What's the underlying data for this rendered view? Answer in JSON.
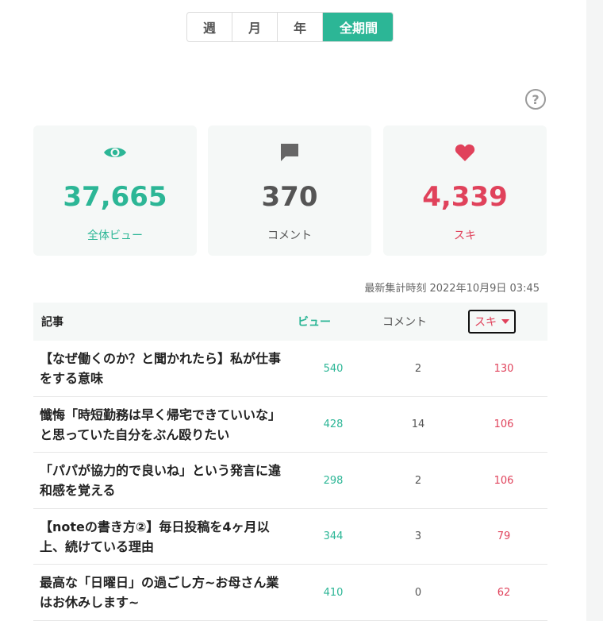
{
  "period_tabs": [
    {
      "label": "週",
      "active": false
    },
    {
      "label": "月",
      "active": false
    },
    {
      "label": "年",
      "active": false
    },
    {
      "label": "全期間",
      "active": true
    }
  ],
  "help_icon": {
    "glyph": "?"
  },
  "stats": {
    "views": {
      "value": "37,665",
      "label": "全体ビュー",
      "icon": "eye-icon"
    },
    "comments": {
      "value": "370",
      "label": "コメント",
      "icon": "comment-icon"
    },
    "likes": {
      "value": "4,339",
      "label": "スキ",
      "icon": "heart-icon"
    }
  },
  "updated_text": "最新集計時刻 2022年10月9日 03:45",
  "table": {
    "headers": {
      "article": "記事",
      "views": "ビュー",
      "comments": "コメント",
      "likes": "スキ"
    },
    "rows": [
      {
        "title": "【なぜ働くのか？と聞かれたら】私が仕事をする意味",
        "views": "540",
        "comments": "2",
        "likes": "130"
      },
      {
        "title": "懺悔「時短勤務は早く帰宅できていいな」と思っていた自分をぶん殴りたい",
        "views": "428",
        "comments": "14",
        "likes": "106"
      },
      {
        "title": "「パパが協力的で良いね」という発言に違和感を覚える",
        "views": "298",
        "comments": "2",
        "likes": "106"
      },
      {
        "title": "【noteの書き方②】毎日投稿を4ヶ月以上、続けている理由",
        "views": "344",
        "comments": "3",
        "likes": "79"
      },
      {
        "title": "最高な「日曜日」の過ごし方~お母さん業はお休みします~",
        "views": "410",
        "comments": "0",
        "likes": "62"
      }
    ]
  },
  "colors": {
    "accent": "#2cb696",
    "like": "#e0425b",
    "neutral": "#555555"
  }
}
